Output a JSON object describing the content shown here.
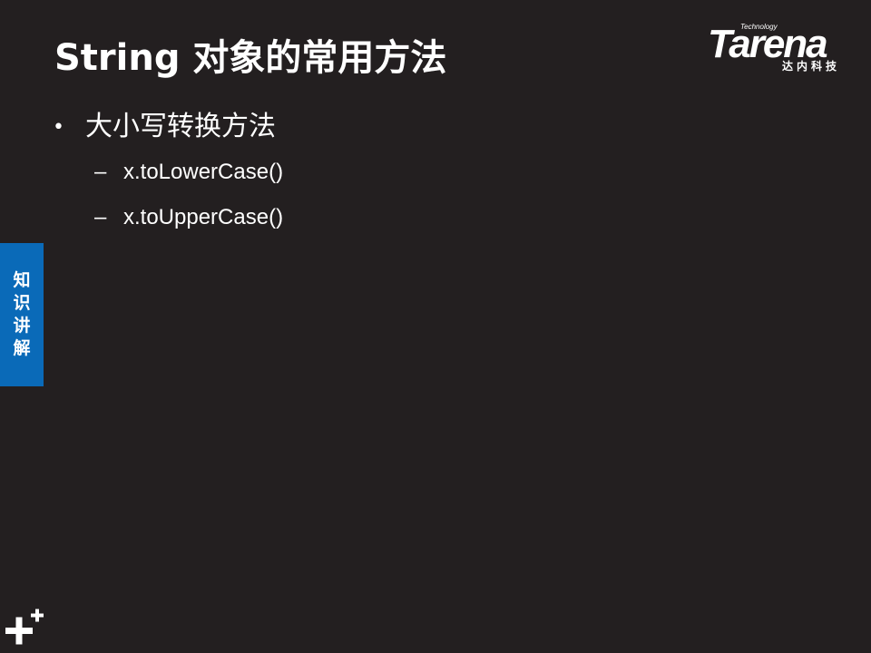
{
  "slide": {
    "title": "String 对象的常用方法",
    "logo": {
      "technology_label": "Technology",
      "brand": "Tarena",
      "chinese": "达内科技"
    },
    "bullets": [
      {
        "text": "大小写转换方法",
        "sub_items": [
          "x.toLowerCase()",
          "x.toUpperCase()"
        ]
      }
    ],
    "side_tab": "知识讲解",
    "icons": {
      "bullet": "•",
      "sub_bullet": "–",
      "corner": "plus-mark-icon"
    },
    "colors": {
      "background": "#231f20",
      "side_tab": "#0a6ab8",
      "text": "#ffffff"
    }
  }
}
